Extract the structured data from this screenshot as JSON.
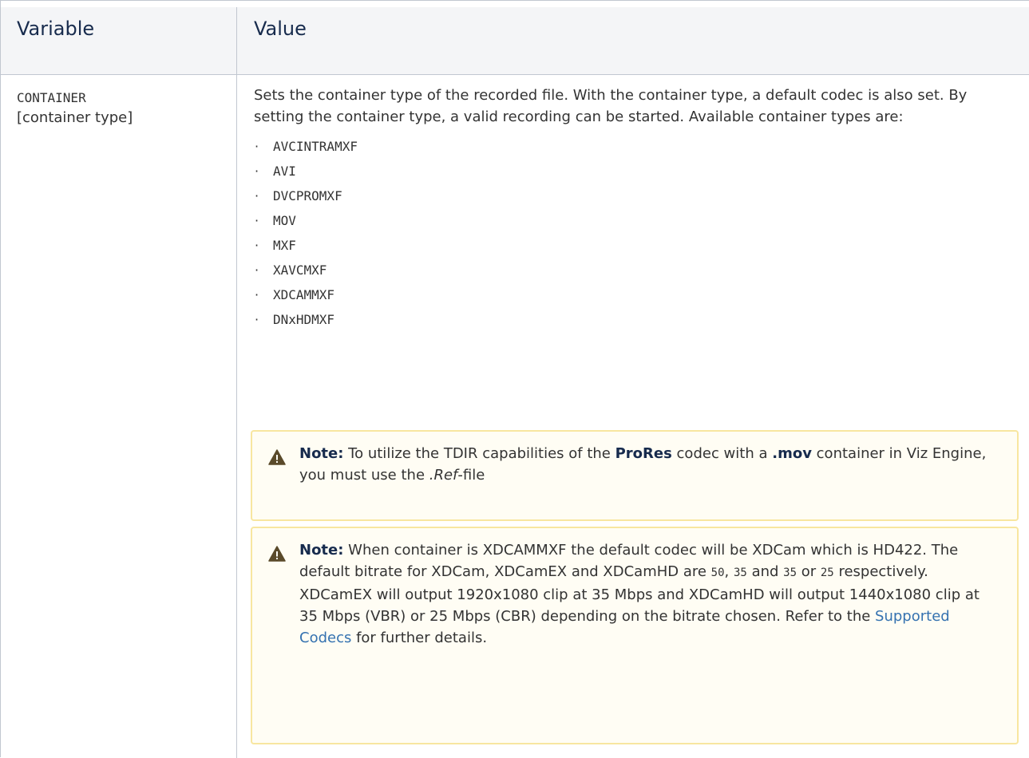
{
  "table": {
    "headers": {
      "variable": "Variable",
      "value": "Value"
    },
    "row": {
      "variable_code": "CONTAINER",
      "variable_desc": "[container type]",
      "description": "Sets the container type of the recorded file. With the container type, a default codec is also set. By setting the container type, a valid recording can be started. Available container types are:",
      "container_types": [
        "AVCINTRAMXF",
        "AVI",
        "DVCPROMXF",
        "MOV",
        "MXF",
        "XAVCMXF",
        "XDCAMMXF",
        "DNxHDMXF"
      ],
      "bullet": "·",
      "note1": {
        "label": "Note:",
        "text_a": " To utilize the TDIR capabilities of the ",
        "prores": "ProRes",
        "text_b": " codec with a ",
        "mov": ".mov",
        "text_c": " container in Viz Engine, you must use the ",
        "ref": ".Ref",
        "text_d": "-file"
      },
      "note2": {
        "label": "Note:",
        "text_a": " When container is XDCAMMXF the default codec will be XDCam which is HD422. The default bitrate for XDCam, XDCamEX and XDCamHD are ",
        "v50": "50",
        "sep1": ", ",
        "v35a": "35",
        "sep2": " and ",
        "v35b": "35",
        "sep3": " or ",
        "v25": "25",
        "text_b": " respectively. XDCamEX will output 1920x1080 clip at 35 Mbps and XDCamHD will output 1440x1080 clip at 35 Mbps (VBR) or 25 Mbps (CBR) depending on the bitrate chosen. Refer to the ",
        "link": "Supported Codecs",
        "text_c": " for further details."
      }
    }
  },
  "colors": {
    "header_bg": "#f4f5f7",
    "border": "#c1c7d0",
    "note_bg": "#fffdf4",
    "note_border": "#f8e6a0",
    "link": "#3572b0",
    "icon": "#5a4a2a"
  }
}
